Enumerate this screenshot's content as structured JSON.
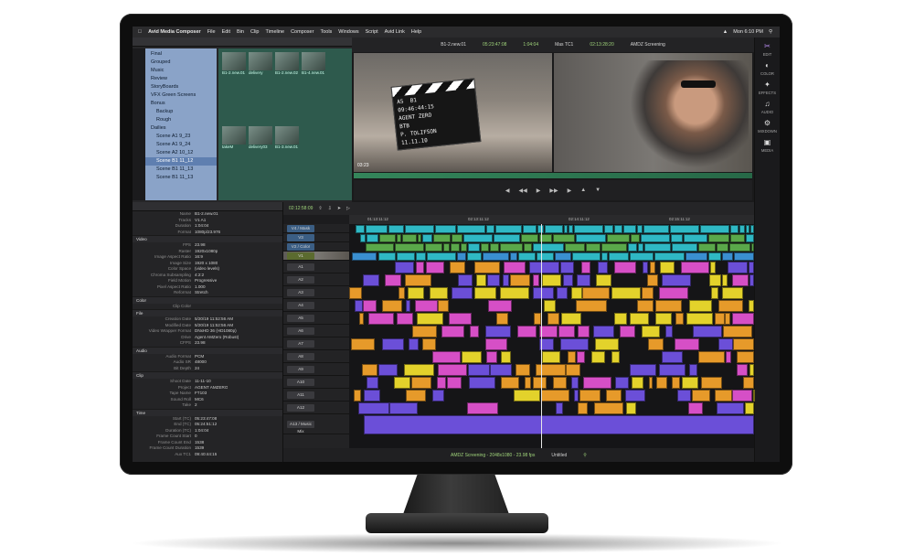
{
  "menubar": {
    "app_name": "Avid Media Composer",
    "items": [
      "File",
      "Edit",
      "Bin",
      "Clip",
      "Timeline",
      "Composer",
      "Tools",
      "Windows",
      "Script",
      "Avid Link",
      "Help"
    ],
    "clock": "Mon 6:10 PM"
  },
  "bins": {
    "items": [
      {
        "label": "Final"
      },
      {
        "label": "Grouped"
      },
      {
        "label": "Music"
      },
      {
        "label": "Review"
      },
      {
        "label": "StoryBoards"
      },
      {
        "label": "VFX Green Screens"
      },
      {
        "label": "Bonus"
      },
      {
        "label": "Backup"
      },
      {
        "label": "Rough"
      },
      {
        "label": "Dailies"
      },
      {
        "label": "Scene A1 9_23"
      },
      {
        "label": "Scene A1 9_24"
      },
      {
        "label": "Scene A2 10_12"
      },
      {
        "label": "Scene B1 11_12"
      },
      {
        "label": "Scene B1 11_13"
      },
      {
        "label": "Scene B1 11_13"
      }
    ],
    "thumbnails": [
      "B1-2.new.01",
      "delivery",
      "B1-2.new.02",
      "B1-4.new.01",
      "takeM",
      "delivery03",
      "B1-3.new.01"
    ]
  },
  "inspector": {
    "fields": [
      {
        "k": "Name",
        "v": "B1-2.new.01"
      },
      {
        "k": "Tracks",
        "v": "V1 A1"
      },
      {
        "k": "Duration",
        "v": "1:04:04"
      },
      {
        "k": "Format",
        "v": "1080p/23.976"
      },
      {
        "section": "Video"
      },
      {
        "k": "FPS",
        "v": "23.98"
      },
      {
        "k": "Raster",
        "v": "1920x1080p"
      },
      {
        "k": "Image Aspect Ratio",
        "v": "16:9"
      },
      {
        "k": "Image Size",
        "v": "1920 x 1080"
      },
      {
        "k": "Color Space",
        "v": "(video levels)"
      },
      {
        "k": "Chroma Subsampling",
        "v": "4:2:2"
      },
      {
        "k": "Field Motion",
        "v": "Progressive"
      },
      {
        "k": "Pixel Aspect Ratio",
        "v": "1.000"
      },
      {
        "k": "Reformat",
        "v": "Stretch"
      },
      {
        "section": "Color"
      },
      {
        "k": "Clip Color",
        "v": ""
      },
      {
        "section": "File"
      },
      {
        "k": "Creation Date",
        "v": "5/20/19 11:52:56 AM"
      },
      {
        "k": "Modified Date",
        "v": "5/20/19 11:52:56 AM"
      },
      {
        "k": "Video Wrapper Format",
        "v": "DNxHD 36 (HD1080p)"
      },
      {
        "k": "Drive",
        "v": "Agent AMZero (Robust)"
      },
      {
        "k": "CFPS",
        "v": "23.98"
      },
      {
        "section": "Audio"
      },
      {
        "k": "Audio Format",
        "v": "PCM"
      },
      {
        "k": "Audio SR",
        "v": "48000"
      },
      {
        "k": "Bit Depth",
        "v": "24"
      },
      {
        "section": "Clip"
      },
      {
        "k": "Shoot Date",
        "v": "11-11-10"
      },
      {
        "k": "Project",
        "v": "AGENT AMZERO"
      },
      {
        "k": "Tape Name",
        "v": "FT103"
      },
      {
        "k": "Sound Roll",
        "v": "MC6"
      },
      {
        "k": "Take",
        "v": "2"
      },
      {
        "section": "Time"
      },
      {
        "k": "Start (TC)",
        "v": "05:23:47:08"
      },
      {
        "k": "End (TC)",
        "v": "05:24:51:12"
      },
      {
        "k": "Duration (TC)",
        "v": "1:04:04"
      },
      {
        "k": "Frame Count Start",
        "v": "0"
      },
      {
        "k": "Frame Count End",
        "v": "1538"
      },
      {
        "k": "Frame Count Duration",
        "v": "1539"
      },
      {
        "k": "Aux TC1",
        "v": "09:40:44:15"
      }
    ]
  },
  "composer": {
    "source_name": "B1-2.new.01",
    "source_tc": "05:23:47:08",
    "duration": "1:04:04",
    "record_label": "Mas TC1",
    "record_tc": "02:13:28:20",
    "sequence_name": "AMDZ Screening",
    "overlay_tc": "03:23"
  },
  "slate": {
    "scene": "A5",
    "shot": "B1",
    "tc": "09:46:44:15",
    "prod": "AGENT ZERO",
    "director": "BTB",
    "camera": "P. TOLIFSON",
    "date": "11.11.10"
  },
  "palette": [
    "EDIT",
    "COLOR",
    "EFFECTS",
    "AUDIO",
    "MIXDOWN",
    "MEDIA"
  ],
  "timeline": {
    "current_tc": "02:12:58:09",
    "ruler": [
      "01:13:11:12",
      "02:13:11:12",
      "02:14:11:12",
      "02:15:11:12"
    ],
    "tracks": [
      {
        "label": "V4 / Mask",
        "kind": "video"
      },
      {
        "label": "V3",
        "kind": "video"
      },
      {
        "label": "V2 / Color",
        "kind": "video"
      },
      {
        "label": "V1",
        "kind": "rec"
      },
      {
        "label": "A1",
        "kind": "audio"
      },
      {
        "label": "A2",
        "kind": "audio"
      },
      {
        "label": "A3",
        "kind": "audio"
      },
      {
        "label": "A4",
        "kind": "audio"
      },
      {
        "label": "A5",
        "kind": "audio"
      },
      {
        "label": "A6",
        "kind": "audio"
      },
      {
        "label": "A7",
        "kind": "audio"
      },
      {
        "label": "A8",
        "kind": "audio"
      },
      {
        "label": "A9",
        "kind": "audio"
      },
      {
        "label": "A10",
        "kind": "audio"
      },
      {
        "label": "A11",
        "kind": "audio"
      },
      {
        "label": "A12",
        "kind": "audio"
      },
      {
        "label": "A13 / Music Mix",
        "kind": "audio"
      }
    ],
    "status_sequence": "AMDZ Screening - 2048x1080 - 23.98 fps",
    "status_mode": "Untitled"
  },
  "colors": {
    "v_track_teal": "#2fb8c4",
    "v_track_green": "#5aa84a",
    "audio_yellow": "#e3d22b",
    "audio_orange": "#e69a2a",
    "audio_magenta": "#d64fc6",
    "audio_purple": "#6b4fd8",
    "playhead": "#e8e8e8"
  }
}
